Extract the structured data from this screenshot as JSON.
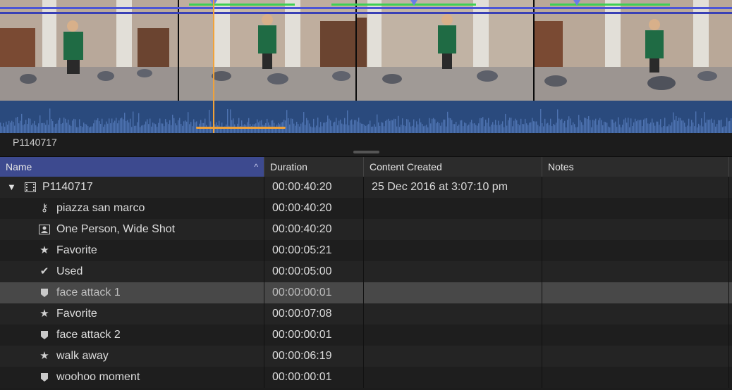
{
  "colors": {
    "accent": "#3d4a8f",
    "playhead": "#f0a23a",
    "range": "#3fcf55",
    "waveform": "#2a4a7d"
  },
  "clip_label": "P1140717",
  "columns": {
    "name": "Name",
    "duration": "Duration",
    "content_created": "Content Created",
    "notes": "Notes"
  },
  "sort_indicator": "^",
  "rows": [
    {
      "icon": "film-icon",
      "name": "P1140717",
      "duration": "00:00:40:20",
      "content_created": "25 Dec 2016 at 3:07:10 pm",
      "notes": ""
    },
    {
      "icon": "keyword-icon",
      "name": "piazza san marco",
      "duration": "00:00:40:20",
      "content_created": "",
      "notes": ""
    },
    {
      "icon": "person-icon",
      "name": "One Person, Wide Shot",
      "duration": "00:00:40:20",
      "content_created": "",
      "notes": ""
    },
    {
      "icon": "star-icon",
      "name": "Favorite",
      "duration": "00:00:05:21",
      "content_created": "",
      "notes": ""
    },
    {
      "icon": "checkmark-icon",
      "name": "Used",
      "duration": "00:00:05:00",
      "content_created": "",
      "notes": ""
    },
    {
      "icon": "marker-icon",
      "name": "face attack 1",
      "duration": "00:00:00:01",
      "content_created": "",
      "notes": ""
    },
    {
      "icon": "star-icon",
      "name": "Favorite",
      "duration": "00:00:07:08",
      "content_created": "",
      "notes": ""
    },
    {
      "icon": "marker-icon",
      "name": "face attack 2",
      "duration": "00:00:00:01",
      "content_created": "",
      "notes": ""
    },
    {
      "icon": "star-icon",
      "name": "walk away",
      "duration": "00:00:06:19",
      "content_created": "",
      "notes": ""
    },
    {
      "icon": "marker-icon",
      "name": "woohoo moment",
      "duration": "00:00:00:01",
      "content_created": "",
      "notes": ""
    }
  ]
}
